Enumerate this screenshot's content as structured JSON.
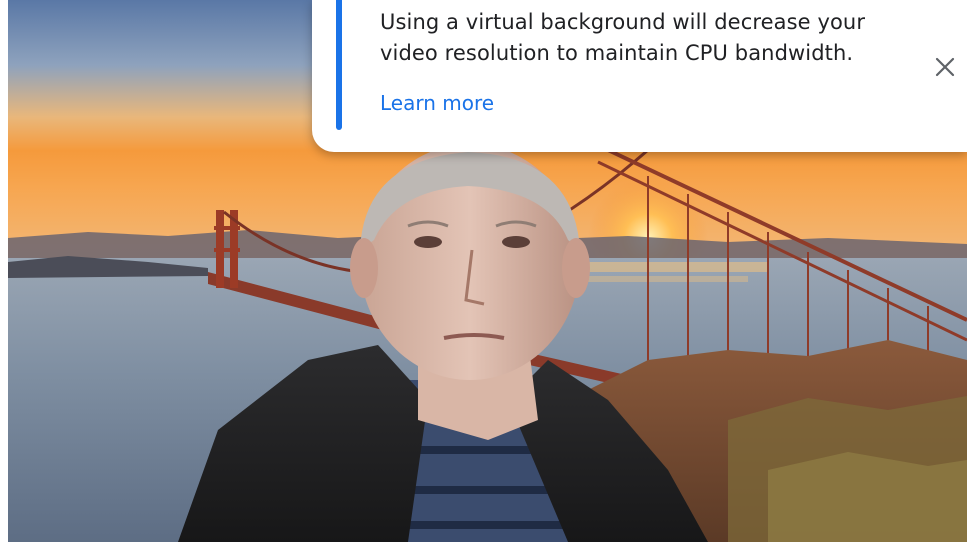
{
  "notification": {
    "message_line_1": "Using a virtual background will decrease your",
    "message_line_2": "video resolution to maintain CPU bandwidth.",
    "link_label": "Learn more",
    "close_icon": "close-icon",
    "accent_color": "#1a73e8"
  },
  "video": {
    "background_scene": "golden-gate-bridge-sunset"
  }
}
